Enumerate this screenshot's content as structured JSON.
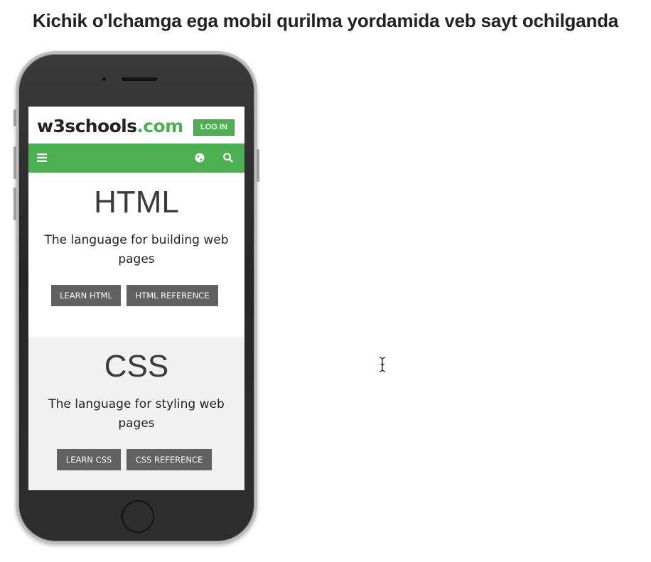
{
  "slide": {
    "title": "Kichik o'lchamga ega mobil qurilma yordamida veb sayt ochilganda"
  },
  "site": {
    "logo_main": "w3schools",
    "logo_suffix": ".com",
    "login_label": "LOG IN",
    "brand_color": "#4caf50",
    "nav_icons": [
      "menu-icon",
      "globe-icon",
      "search-icon"
    ]
  },
  "sections": [
    {
      "heading": "HTML",
      "description": "The language for building web pages",
      "buttons": [
        "LEARN HTML",
        "HTML REFERENCE"
      ]
    },
    {
      "heading": "CSS",
      "description": "The language for styling web pages",
      "buttons": [
        "LEARN CSS",
        "CSS REFERENCE"
      ]
    }
  ]
}
